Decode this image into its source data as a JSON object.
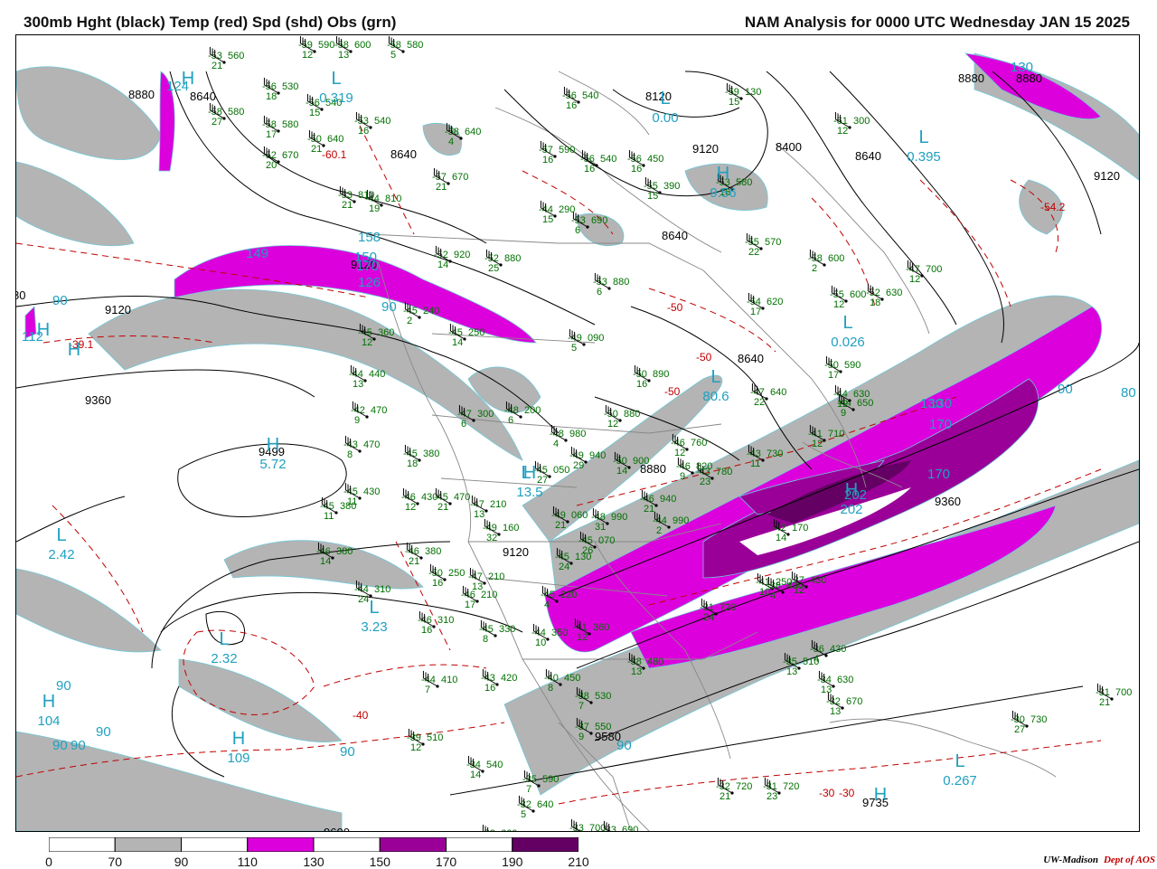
{
  "header": {
    "left_title": "300mb Hght (black) Temp (red) Spd (shd) Obs (grn)",
    "right_title": "NAM Analysis for 0000 UTC Wednesday  JAN 15 2025"
  },
  "colors": {
    "speed_70_90": "#b4b4b4",
    "speed_110_130": "#dc00dc",
    "speed_150_170": "#9a0098",
    "speed_190_210": "#640064",
    "height_contour": "#000000",
    "temperature_contour": "#c00000",
    "observations": "#007000",
    "center_labels": "#20a0c0",
    "country_borders": "#888888"
  },
  "legend": {
    "labels": [
      "0",
      "70",
      "90",
      "110",
      "130",
      "150",
      "170",
      "190",
      "210"
    ],
    "fills": [
      "#ffffff",
      "#b4b4b4",
      "#ffffff",
      "#dc00dc",
      "#ffffff",
      "#9a0098",
      "#ffffff",
      "#640064"
    ]
  },
  "height_labels": [
    {
      "text": "8880"
    },
    {
      "text": "8640"
    },
    {
      "text": "8640"
    },
    {
      "text": "8120"
    },
    {
      "text": "8400"
    },
    {
      "text": "8640"
    },
    {
      "text": "8880"
    },
    {
      "text": "9120"
    },
    {
      "text": "8640"
    },
    {
      "text": "9120"
    },
    {
      "text": "9360"
    },
    {
      "text": "9499"
    },
    {
      "text": "8640"
    },
    {
      "text": "8880"
    },
    {
      "text": "9360"
    },
    {
      "text": "9120"
    },
    {
      "text": "9120"
    },
    {
      "text": "9580"
    },
    {
      "text": "9735"
    },
    {
      "text": "9600"
    },
    {
      "text": "9120"
    },
    {
      "text": "8880"
    },
    {
      "text": "80"
    }
  ],
  "temp_labels": [
    {
      "text": "-39.1"
    },
    {
      "text": "-50"
    },
    {
      "text": "-50"
    },
    {
      "text": "-50"
    },
    {
      "text": "-54.2"
    },
    {
      "text": "-40"
    },
    {
      "text": "-30"
    },
    {
      "text": "-30"
    },
    {
      "text": "-60.1"
    }
  ],
  "speed_labels": [
    {
      "text": "90"
    },
    {
      "text": "112"
    },
    {
      "text": "149"
    },
    {
      "text": "124"
    },
    {
      "text": "170"
    },
    {
      "text": "150"
    },
    {
      "text": "90"
    },
    {
      "text": "130"
    },
    {
      "text": "90"
    },
    {
      "text": "80"
    },
    {
      "text": "130"
    },
    {
      "text": "170"
    },
    {
      "text": "170"
    },
    {
      "text": "202"
    },
    {
      "text": "90"
    },
    {
      "text": "90"
    },
    {
      "text": "90"
    },
    {
      "text": "90"
    },
    {
      "text": "90"
    },
    {
      "text": "130"
    },
    {
      "text": "158"
    },
    {
      "text": "126"
    },
    {
      "text": "90"
    }
  ],
  "center_labels": [
    {
      "letter": "H",
      "value": ""
    },
    {
      "letter": "L",
      "value": "0.319"
    },
    {
      "letter": "L",
      "value": "0.395"
    },
    {
      "letter": "L",
      "value": "0.00"
    },
    {
      "letter": "H",
      "value": "9.56"
    },
    {
      "letter": "L",
      "value": "0.026"
    },
    {
      "letter": "L",
      "value": "80.6"
    },
    {
      "letter": "L",
      "value": "2.42"
    },
    {
      "letter": "L",
      "value": "3.23"
    },
    {
      "letter": "L",
      "value": "2.32"
    },
    {
      "letter": "H",
      "value": "104"
    },
    {
      "letter": "H",
      "value": "109"
    },
    {
      "letter": "L",
      "value": "0.267"
    },
    {
      "letter": "H",
      "value": "5.72"
    },
    {
      "letter": "H",
      "value": "13.5"
    },
    {
      "letter": "L",
      "value": ""
    },
    {
      "letter": "H",
      "value": "202"
    },
    {
      "letter": "H",
      "value": ""
    },
    {
      "letter": "H",
      "value": ""
    },
    {
      "letter": "H",
      "value": ""
    }
  ],
  "observations": [
    {
      "t": "-53",
      "h": "560",
      "w": "21"
    },
    {
      "t": "-59",
      "h": "590",
      "w": "12"
    },
    {
      "t": "-58",
      "h": "600",
      "w": "13"
    },
    {
      "t": "-58",
      "h": "580",
      "w": "5"
    },
    {
      "t": "-56",
      "h": "530",
      "w": "18"
    },
    {
      "t": "-56",
      "h": "540",
      "w": "15"
    },
    {
      "t": "-58",
      "h": "580",
      "w": "27"
    },
    {
      "t": "-53",
      "h": "540",
      "w": "16"
    },
    {
      "t": "-58",
      "h": "580",
      "w": "17"
    },
    {
      "t": "-50",
      "h": "640",
      "w": "21"
    },
    {
      "t": "-52",
      "h": "670",
      "w": "20"
    },
    {
      "t": "-58",
      "h": "640",
      "w": "4"
    },
    {
      "t": "-57",
      "h": "670",
      "w": "21"
    },
    {
      "t": "-53",
      "h": "810",
      "w": "21"
    },
    {
      "t": "-44",
      "h": "810",
      "w": "19"
    },
    {
      "t": "-52",
      "h": "920",
      "w": "14"
    },
    {
      "t": "-52",
      "h": "880",
      "w": "25"
    },
    {
      "t": "-45",
      "h": "240",
      "w": "2"
    },
    {
      "t": "-45",
      "h": "250",
      "w": "14"
    },
    {
      "t": "-45",
      "h": "360",
      "w": "12"
    },
    {
      "t": "-44",
      "h": "440",
      "w": "13"
    },
    {
      "t": "-42",
      "h": "470",
      "w": "9"
    },
    {
      "t": "-43",
      "h": "470",
      "w": "8"
    },
    {
      "t": "-45",
      "h": "380",
      "w": "18"
    },
    {
      "t": "-47",
      "h": "300",
      "w": "6"
    },
    {
      "t": "-48",
      "h": "200",
      "w": "6"
    },
    {
      "t": "-45",
      "h": "430",
      "w": "11"
    },
    {
      "t": "-46",
      "h": "430",
      "w": "12"
    },
    {
      "t": "-45",
      "h": "470",
      "w": "21"
    },
    {
      "t": "-45",
      "h": "380",
      "w": "11"
    },
    {
      "t": "-46",
      "h": "380",
      "w": "14"
    },
    {
      "t": "-46",
      "h": "380",
      "w": "21"
    },
    {
      "t": "-44",
      "h": "310",
      "w": "24"
    },
    {
      "t": "-50",
      "h": "250",
      "w": "16"
    },
    {
      "t": "-49",
      "h": "160",
      "w": "32"
    },
    {
      "t": "-47",
      "h": "210",
      "w": "13"
    },
    {
      "t": "-46",
      "h": "310",
      "w": "16"
    },
    {
      "t": "-45",
      "h": "330",
      "w": "8"
    },
    {
      "t": "-44",
      "h": "350",
      "w": "10"
    },
    {
      "t": "-44",
      "h": "410",
      "w": "7"
    },
    {
      "t": "-43",
      "h": "420",
      "w": "16"
    },
    {
      "t": "-39",
      "h": "510",
      "w": "12"
    },
    {
      "t": "-34",
      "h": "540",
      "w": "14"
    },
    {
      "t": "-35",
      "h": "590",
      "w": "7"
    },
    {
      "t": "-32",
      "h": "640",
      "w": "5"
    },
    {
      "t": "-32",
      "h": "660",
      "w": "5"
    },
    {
      "t": "-33",
      "h": "700",
      "w": "5"
    },
    {
      "t": "-33",
      "h": "690",
      "w": "5"
    },
    {
      "t": "-32",
      "h": "720",
      "w": "21"
    },
    {
      "t": "-31",
      "h": "720",
      "w": "23"
    },
    {
      "t": "-38",
      "h": "530",
      "w": "7"
    },
    {
      "t": "-37",
      "h": "550",
      "w": "9"
    },
    {
      "t": "-40",
      "h": "450",
      "w": "8"
    },
    {
      "t": "-38",
      "h": "480",
      "w": "13"
    },
    {
      "t": "-41",
      "h": "360",
      "w": "12"
    },
    {
      "t": "-45",
      "h": "220",
      "w": "4"
    },
    {
      "t": "-46",
      "h": "210",
      "w": "17"
    },
    {
      "t": "-45",
      "h": "130",
      "w": "24"
    },
    {
      "t": "-45",
      "h": "070",
      "w": "26"
    },
    {
      "t": "-49",
      "h": "060",
      "w": "21"
    },
    {
      "t": "-48",
      "h": "990",
      "w": "31"
    },
    {
      "t": "-47",
      "h": "210",
      "w": "13"
    },
    {
      "t": "-50",
      "h": "900",
      "w": "14"
    },
    {
      "t": "-49",
      "h": "940",
      "w": "29"
    },
    {
      "t": "-45",
      "h": "050",
      "w": "27"
    },
    {
      "t": "-48",
      "h": "980",
      "w": "4"
    },
    {
      "t": "-46",
      "h": "940",
      "w": "21"
    },
    {
      "t": "-44",
      "h": "990",
      "w": "2"
    },
    {
      "t": "-50",
      "h": "880",
      "w": "12"
    },
    {
      "t": "-50",
      "h": "890",
      "w": "16"
    },
    {
      "t": "-49",
      "h": "090",
      "w": "5"
    },
    {
      "t": "-53",
      "h": "880",
      "w": "6"
    },
    {
      "t": "-53",
      "h": "690",
      "w": "6"
    },
    {
      "t": "-54",
      "h": "620",
      "w": "17"
    },
    {
      "t": "-55",
      "h": "570",
      "w": "22"
    },
    {
      "t": "-58",
      "h": "600",
      "w": "2"
    },
    {
      "t": "-55",
      "h": "600",
      "w": "12"
    },
    {
      "t": "-52",
      "h": "630",
      "w": "18"
    },
    {
      "t": "-47",
      "h": "700",
      "w": "12"
    },
    {
      "t": "-50",
      "h": "590",
      "w": "17"
    },
    {
      "t": "-47",
      "h": "640",
      "w": "22"
    },
    {
      "t": "-44",
      "h": "650",
      "w": "9"
    },
    {
      "t": "-44",
      "h": "630",
      "w": "12"
    },
    {
      "t": "-41",
      "h": "710",
      "w": "12"
    },
    {
      "t": "-46",
      "h": "760",
      "w": "12"
    },
    {
      "t": "-43",
      "h": "730",
      "w": "11"
    },
    {
      "t": "-43",
      "h": "780",
      "w": "23"
    },
    {
      "t": "-46",
      "h": "820",
      "w": "9"
    },
    {
      "t": "-42",
      "h": "170",
      "w": "14"
    },
    {
      "t": "-41",
      "h": "250",
      "w": "10"
    },
    {
      "t": "-38",
      "h": "430",
      "w": "4"
    },
    {
      "t": "-37",
      "h": "430",
      "w": "12"
    },
    {
      "t": "-36",
      "h": "430",
      "w": "4"
    },
    {
      "t": "-35",
      "h": "510",
      "w": "13"
    },
    {
      "t": "-34",
      "h": "630",
      "w": "13"
    },
    {
      "t": "-32",
      "h": "670",
      "w": "13"
    },
    {
      "t": "-31",
      "h": "700",
      "w": "21"
    },
    {
      "t": "-30",
      "h": "730",
      "w": "27"
    },
    {
      "t": "-31",
      "h": "720",
      "w": "24"
    },
    {
      "t": "-44",
      "h": "290",
      "w": "15"
    },
    {
      "t": "-57",
      "h": "590",
      "w": "16"
    },
    {
      "t": "-56",
      "h": "540",
      "w": "16"
    },
    {
      "t": "-59",
      "h": "130",
      "w": "15"
    },
    {
      "t": "-61",
      "h": "300",
      "w": "12"
    },
    {
      "t": "-53",
      "h": "580",
      "w": "16"
    },
    {
      "t": "-56",
      "h": "450",
      "w": "16"
    },
    {
      "t": "-55",
      "h": "390",
      "w": "15"
    },
    {
      "t": "-56",
      "h": "540",
      "w": "16"
    },
    {
      "t": "-58",
      "h": "640",
      "w": "4"
    }
  ],
  "credit": {
    "org": "UW-Madison",
    "dept": "Dept of AOS"
  }
}
